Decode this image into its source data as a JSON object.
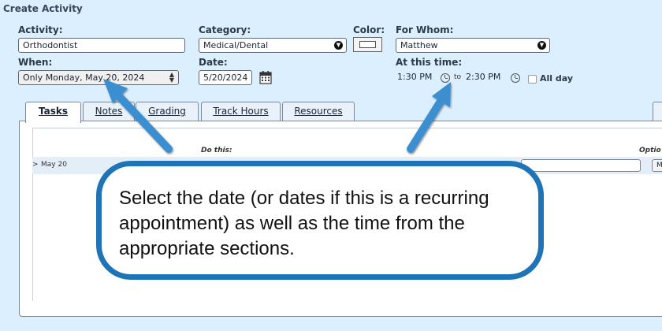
{
  "page": {
    "title": "Create Activity"
  },
  "activity": {
    "label": "Activity:",
    "value": "Orthodontist"
  },
  "category": {
    "label": "Category:",
    "value": "Medical/Dental"
  },
  "color": {
    "label": "Color:",
    "value": "#ffffff"
  },
  "for_whom": {
    "label": "For Whom:",
    "value": "Matthew"
  },
  "when": {
    "label": "When:",
    "value": "Only Monday, May 20, 2024"
  },
  "date": {
    "label": "Date:",
    "value": "5/20/2024"
  },
  "time": {
    "label": "At this time:",
    "start": "1:30 PM",
    "to": "to",
    "end": "2:30 PM",
    "all_day_label": "All day",
    "all_day_checked": false
  },
  "tabs": [
    {
      "label": "Tasks",
      "active": true
    },
    {
      "label": "Notes",
      "active": false
    },
    {
      "label": "Grading",
      "active": false
    },
    {
      "label": "Track Hours",
      "active": false
    },
    {
      "label": "Resources",
      "active": false
    }
  ],
  "tasks": {
    "do_this_header": "Do this:",
    "options_header": "Optio",
    "row_toggle": ">",
    "row_date": "May 20",
    "more_button": "More"
  },
  "callout": {
    "text": "Select the date (or dates if this is a recurring appointment) as well as the time from the appropriate sections."
  },
  "colors": {
    "background": "#dcefff",
    "callout_border": "#1f74b8",
    "arrow": "#3b8fd0"
  }
}
